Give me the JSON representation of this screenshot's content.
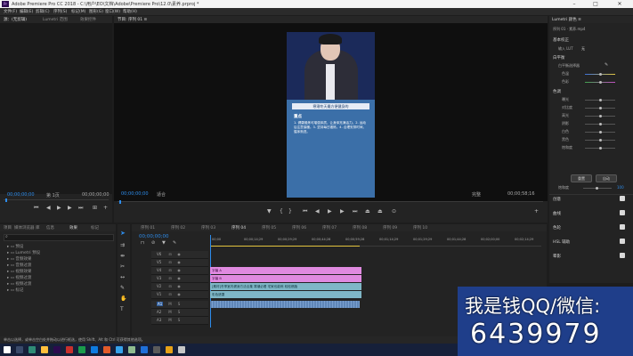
{
  "app": {
    "title": "Adobe Premiere Pro CC 2018 - C:\\用户\\EO\\文档\\Adobe\\Premiere Pro\\12.0\\素养.prproj *",
    "logo_text": "Pr"
  },
  "menu": [
    "文件(F)",
    "编辑(E)",
    "剪辑(C)",
    "序列(S)",
    "标记(M)",
    "图形(G)",
    "窗口(W)",
    "帮助(H)"
  ],
  "source_panel": {
    "tabs": [
      "源：(无剪辑)",
      "Lumetri 范围",
      "效果控件",
      "音频剪辑混合器"
    ],
    "timecode_left": "00;00;00;00",
    "page_label": "第 1页",
    "timecode_right": "00;00;00;00"
  },
  "program_panel": {
    "tab": "节目: 序列 01 ≡",
    "timecode_left": "00;00;00;00",
    "fit_label": "适合",
    "quality_label": "完整",
    "timecode_right": "00;00;58;16",
    "video_caption": {
      "heading": "寒潮冬天最方便健身的",
      "section": "重点",
      "body": "1. 健康锻炼可增强体质，让身体充满活力。2. 运动后注意保暖。3. 坚持每日锻炼。4. 合理安排时间，循序渐进。"
    }
  },
  "project_panel": {
    "tabs": [
      "项目",
      "媒体浏览器",
      "库",
      "信息",
      "效果",
      "标记"
    ],
    "tree": [
      "预设",
      "Lumetri 预设",
      "音频效果",
      "音频过渡",
      "视频效果",
      "视频过渡",
      "视频过渡",
      "标记"
    ]
  },
  "timeline": {
    "sequence_tabs": [
      "序列 01",
      "序列 02",
      "序列 03",
      "序列 04",
      "序列 05",
      "序列 06",
      "序列 07",
      "序列 08",
      "序列 09",
      "序列 10"
    ],
    "timecode": "00;00;00;00",
    "ruler_marks": [
      "00;00",
      "00;00;14;29",
      "00;00;29;29",
      "00;00;44;28",
      "00;00;59;28",
      "00;01;14;29",
      "00;01;29;29",
      "00;01;44;28",
      "00;02;00;00",
      "00;02;14;29"
    ],
    "tracks": [
      {
        "name": "V6",
        "clip": ""
      },
      {
        "name": "V5",
        "clip": ""
      },
      {
        "name": "V4",
        "clip": "字幕 A"
      },
      {
        "name": "V3",
        "clip": "字幕 B"
      },
      {
        "name": "V2",
        "clip": "[素材]冬季室内健身方法合集 寒潮必看 宅家也能练 轻松燃脂"
      },
      {
        "name": "V1",
        "clip": "彩色遮罩"
      },
      {
        "name": "A1",
        "clip": ""
      },
      {
        "name": "A2",
        "clip": ""
      },
      {
        "name": "A3",
        "clip": ""
      }
    ]
  },
  "effects_panel": {
    "tabs": [
      "Lumetri 颜色 ≡",
      "基本校正",
      "序列 01 · 素养.mp4"
    ],
    "section_basic": "基本校正",
    "input_lut_label": "输入 LUT",
    "input_lut_value": "无",
    "section_wb": "白平衡",
    "wb_selector": "白平衡选择器",
    "temperature": "色温",
    "tint": "色彩",
    "section_tone": "色调",
    "tone_items": [
      "曝光",
      "对比度",
      "高光",
      "阴影",
      "白色",
      "黑色",
      "饱和度"
    ],
    "reset": "重置",
    "auto": "自动",
    "saturation_label": "饱和度",
    "saturation_value": "100",
    "sections": [
      "创意",
      "曲线",
      "色轮",
      "HSL 辅助",
      "晕影"
    ]
  },
  "status_bar": "单击以选择，或单击空白处并拖动以进行框选，使用 Shift、Alt 和 Ctrl 可获得其他选项。",
  "watermark": {
    "line1": "我是钱QQ/微信:",
    "line2": "6439979"
  },
  "colors": {
    "accent": "#2d8ceb",
    "pink_clip": "#e08ae0",
    "teal_clip": "#7fb7c7",
    "audio_clip": "#5f86b8"
  }
}
